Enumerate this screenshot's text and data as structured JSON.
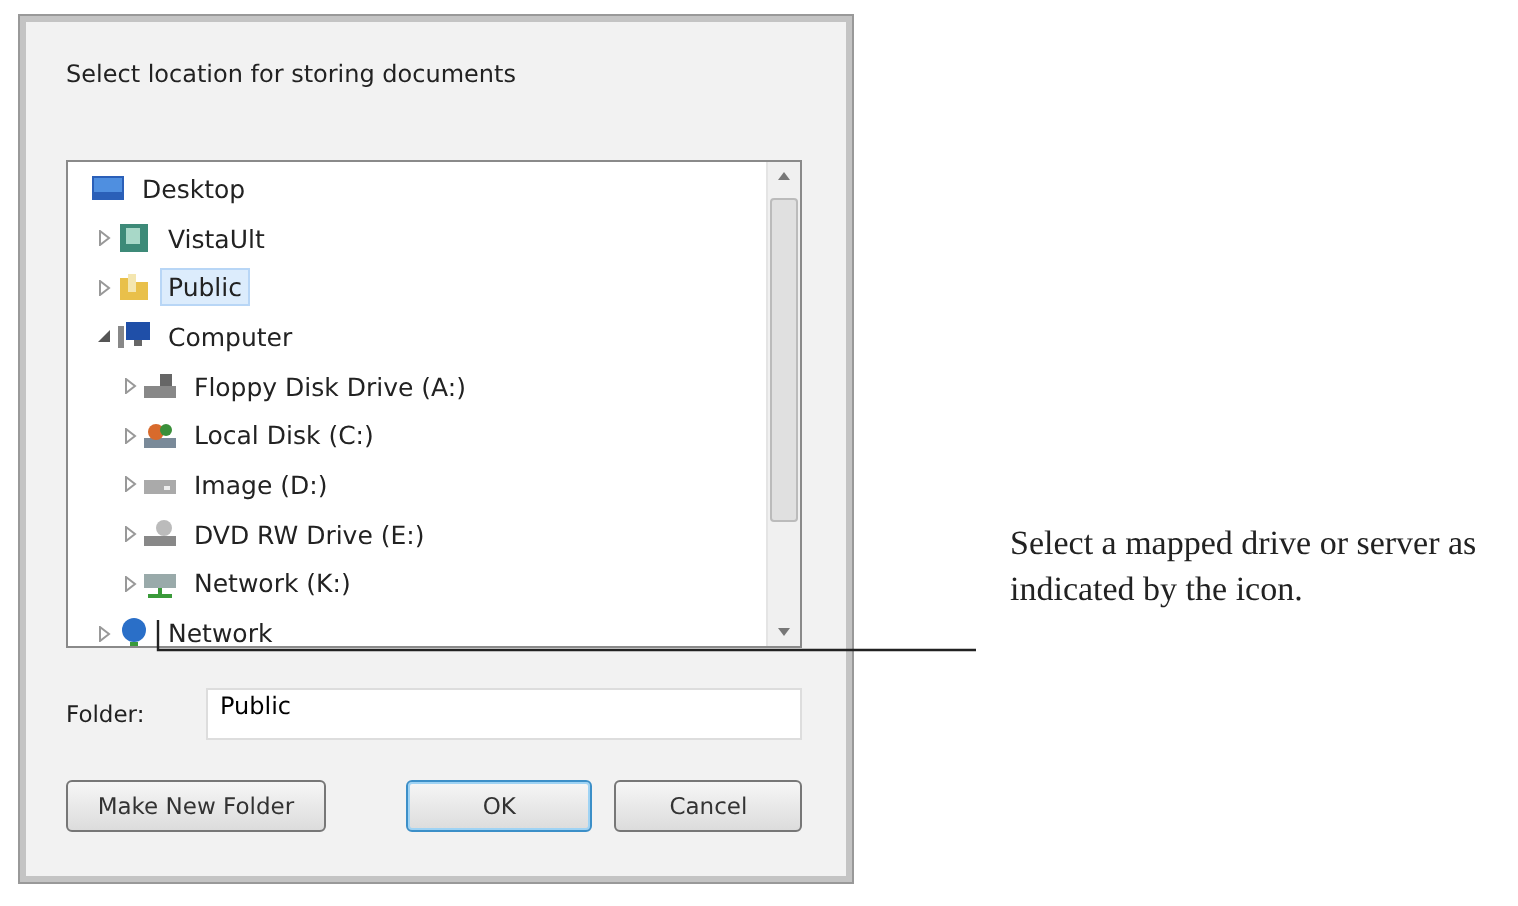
{
  "dialog": {
    "prompt": "Select location for storing documents",
    "tree": [
      {
        "label": "Desktop",
        "kind": "desktop",
        "selected": false,
        "children": [
          {
            "label": "VistaUlt",
            "kind": "user",
            "expanded": false,
            "selected": false
          },
          {
            "label": "Public",
            "kind": "folder",
            "expanded": false,
            "selected": true
          },
          {
            "label": "Computer",
            "kind": "computer",
            "expanded": true,
            "selected": false,
            "children": [
              {
                "label": "Floppy Disk Drive (A:)",
                "kind": "floppy",
                "expanded": false,
                "selected": false
              },
              {
                "label": "Local Disk (C:)",
                "kind": "disk",
                "expanded": false,
                "selected": false
              },
              {
                "label": "Image (D:)",
                "kind": "drive",
                "expanded": false,
                "selected": false
              },
              {
                "label": "DVD RW Drive (E:)",
                "kind": "dvd",
                "expanded": false,
                "selected": false
              },
              {
                "label": "Network (K:)",
                "kind": "netdrive",
                "expanded": false,
                "selected": false
              }
            ]
          },
          {
            "label": "Network",
            "kind": "network",
            "expanded": false,
            "selected": false
          }
        ]
      }
    ],
    "folder": {
      "label": "Folder:",
      "value": "Public"
    },
    "buttons": [
      {
        "label": "Make New Folder",
        "default": false
      },
      {
        "label": "OK",
        "default": true
      },
      {
        "label": "Cancel",
        "default": false
      }
    ]
  },
  "callout": "Select a mapped drive or server as indicated by the icon."
}
